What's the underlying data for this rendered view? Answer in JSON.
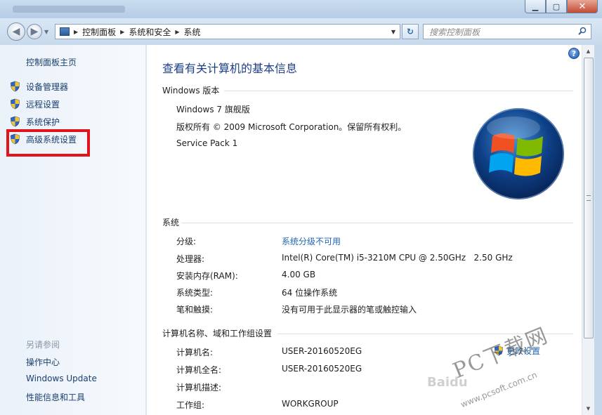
{
  "addressbar": {
    "breadcrumb": [
      "控制面板",
      "系统和安全",
      "系统"
    ],
    "search_placeholder": "搜索控制面板"
  },
  "leftpane": {
    "home": "控制面板主页",
    "items": [
      "设备管理器",
      "远程设置",
      "系统保护",
      "高级系统设置"
    ],
    "see_also": "另请参阅",
    "links": [
      "操作中心",
      "Windows Update",
      "性能信息和工具"
    ]
  },
  "main": {
    "title": "查看有关计算机的基本信息",
    "edition_section": "Windows 版本",
    "edition": "Windows 7 旗舰版",
    "copyright": "版权所有 © 2009 Microsoft Corporation。保留所有权利。",
    "service_pack": "Service Pack 1",
    "system_section": "系统",
    "system_rows": [
      {
        "label": "分级:",
        "value": "系统分级不可用"
      },
      {
        "label": "处理器:",
        "value": "Intel(R) Core(TM) i5-3210M CPU @ 2.50GHz   2.50 GHz"
      },
      {
        "label": "安装内存(RAM):",
        "value": "4.00 GB"
      },
      {
        "label": "系统类型:",
        "value": "64 位操作系统"
      },
      {
        "label": "笔和触摸:",
        "value": "没有可用于此显示器的笔或触控输入"
      }
    ],
    "computer_section": "计算机名称、域和工作组设置",
    "computer_rows": [
      {
        "label": "计算机名:",
        "value": "USER-20160520EG"
      },
      {
        "label": "计算机全名:",
        "value": "USER-20160520EG"
      },
      {
        "label": "计算机描述:",
        "value": ""
      },
      {
        "label": "工作组:",
        "value": "WORKGROUP"
      }
    ],
    "change_settings": "更改设置",
    "help": "?"
  },
  "watermark": {
    "brand": "PC下载网",
    "url": "www.pcsoft.com.cn",
    "baidu": "Baidu"
  },
  "colors": {
    "link": "#1f63b1",
    "title": "#1f3f8a",
    "highlight": "#e0141a"
  }
}
